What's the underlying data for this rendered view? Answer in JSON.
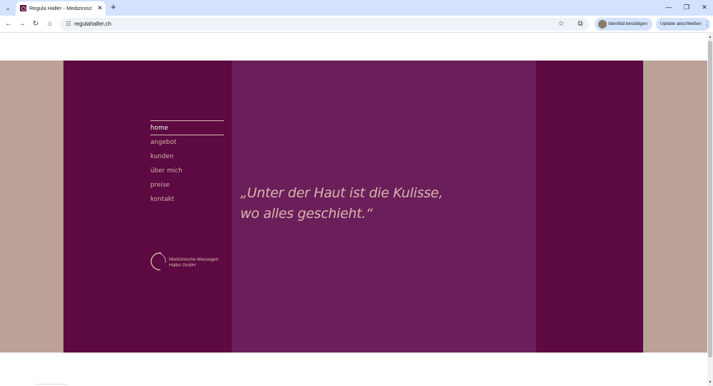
{
  "browser": {
    "tab": {
      "title": "Regula Haller - Medizinische M"
    },
    "url": "regulahaller.ch",
    "identity_label": "Identität bestätigen",
    "update_label": "Update abschließen",
    "icons": [
      "tab-search-icon",
      "close-icon",
      "plus-icon",
      "minimize-icon",
      "restore-icon",
      "back-arrow-icon",
      "forward-arrow-icon",
      "reload-icon",
      "home-icon",
      "site-settings-icon",
      "star-icon",
      "extensions-icon",
      "kebab-menu-icon"
    ]
  },
  "site": {
    "nav": [
      {
        "label": "home",
        "active": true
      },
      {
        "label": "angebot",
        "active": false
      },
      {
        "label": "kunden",
        "active": false
      },
      {
        "label": "über mich",
        "active": false
      },
      {
        "label": "preise",
        "active": false
      },
      {
        "label": "kontakt",
        "active": false
      }
    ],
    "logo": {
      "line1": "Medizinische Massagen",
      "line2": "Haller GmbH"
    },
    "quote": {
      "line1": "„Unter der Haut ist die Kulisse,",
      "line2": "wo alles geschieht.“"
    }
  },
  "colors": {
    "band": "#bca196",
    "panel_dark": "#5c0a41",
    "panel_mid": "#6b1f5a",
    "text_rose": "#d9b6ac",
    "text_active": "#ffffff"
  }
}
